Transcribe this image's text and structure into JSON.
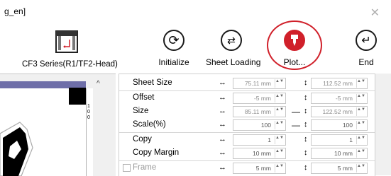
{
  "window": {
    "title": "g_en]",
    "close_glyph": "✕"
  },
  "device": {
    "label": "CF3 Series(R1/TF2-Head)",
    "icon": "plotter-icon"
  },
  "toolbar": {
    "initialize": {
      "label": "Initialize",
      "icon": "refresh-icon"
    },
    "sheet_loading": {
      "label": "Sheet Loading",
      "icon": "swap-arrows-icon"
    },
    "plot": {
      "label": "Plot...",
      "icon": "cutter-icon",
      "highlight_color": "#d0202a"
    },
    "end": {
      "label": "End",
      "icon": "return-arrow-icon"
    }
  },
  "ruler": {
    "marks": [
      "1",
      "0",
      "0"
    ]
  },
  "properties": [
    {
      "name": "Sheet Size",
      "w": "75.11 mm",
      "h": "112.52 mm",
      "lock": false
    },
    {
      "name": "Offset",
      "w": "-5 mm",
      "h": "-5 mm",
      "lock": false
    },
    {
      "name": "Size",
      "w": "85.11 mm",
      "h": "122.52 mm",
      "lock": true
    },
    {
      "name": "Scale(%)",
      "w": "100",
      "h": "100",
      "lock": true
    },
    {
      "name": "Copy",
      "w": "1",
      "h": "1",
      "lock": false
    },
    {
      "name": "Copy Margin",
      "w": "10 mm",
      "h": "10 mm",
      "lock": false
    },
    {
      "name": "Frame",
      "w": "5 mm",
      "h": "5 mm",
      "lock": false,
      "checkbox": true
    }
  ],
  "symbols": {
    "horizontal": "↔",
    "vertical": "↕",
    "lock_dash": "—",
    "spin": "▲▼"
  }
}
